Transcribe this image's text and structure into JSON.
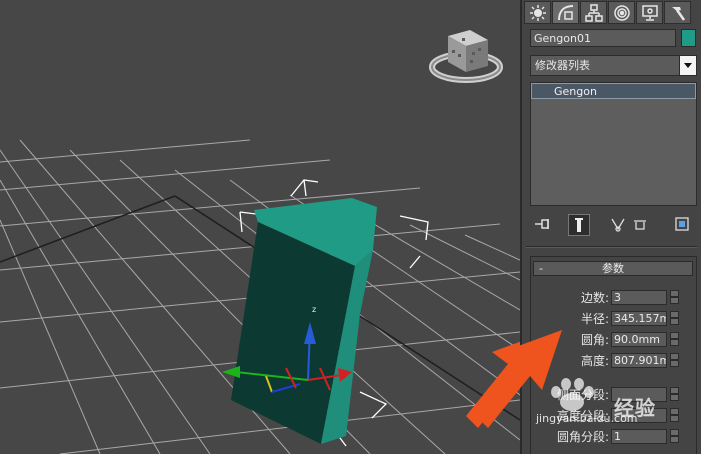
{
  "viewport": {
    "axis_z_label": "z"
  },
  "command_panel": {
    "tabs": [
      {
        "icon": "create-sun-icon"
      },
      {
        "icon": "modify-icon"
      },
      {
        "icon": "hierarchy-icon"
      },
      {
        "icon": "motion-icon"
      },
      {
        "icon": "display-icon"
      },
      {
        "icon": "utilities-hammer-icon"
      }
    ],
    "object_name": "Gengon01",
    "object_color": "#1f9b86",
    "modifier_list": "修改器列表",
    "stack_items": [
      "Gengon"
    ],
    "rollout": {
      "collapse": "-",
      "title": "参数",
      "params": [
        {
          "label": "边数:",
          "value": "3"
        },
        {
          "label": "半径:",
          "value": "345.157m"
        },
        {
          "label": "圆角:",
          "value": "90.0mm"
        },
        {
          "label": "高度:",
          "value": "807.901m"
        },
        {
          "label": "侧面分段:",
          "value": ""
        },
        {
          "label": "高度分段:",
          "value": ""
        },
        {
          "label": "圆角分段:",
          "value": "1"
        }
      ]
    }
  },
  "watermark": {
    "brand": "经验",
    "url": "jingyan.baidu.com"
  },
  "colors": {
    "arrow": "#f0541e",
    "object_top": "#1f9b86",
    "object_front": "#0c3a33",
    "object_side": "#1f8f7c"
  }
}
